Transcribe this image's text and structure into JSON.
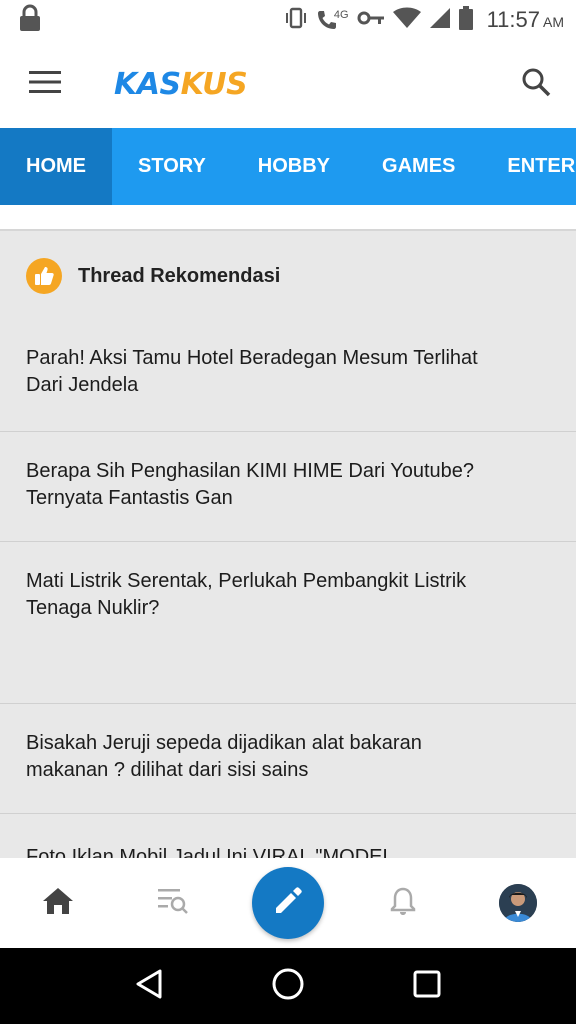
{
  "status_bar": {
    "network_type": "4G",
    "time": "11:57",
    "ampm": "AM",
    "icons": [
      "lock-icon",
      "vibrate-icon",
      "call-icon",
      "vpn-key-icon",
      "wifi-icon",
      "cell-signal-icon",
      "battery-icon"
    ]
  },
  "app_bar": {
    "logo_part1": "KAS",
    "logo_part2": "KUS",
    "icons": [
      "menu-icon",
      "search-icon"
    ],
    "colors": {
      "logo_blue": "#1e88e5",
      "logo_orange": "#f5a623"
    }
  },
  "tabs": [
    {
      "label": "HOME",
      "active": true
    },
    {
      "label": "STORY",
      "active": false
    },
    {
      "label": "HOBBY",
      "active": false
    },
    {
      "label": "GAMES",
      "active": false
    },
    {
      "label": "ENTER",
      "active": false
    }
  ],
  "section": {
    "icon": "thumbs-up-icon",
    "title": "Thread Rekomendasi"
  },
  "threads": [
    {
      "line1": "Parah! Aksi Tamu Hotel Beradegan Mesum Terlihat",
      "line2": "Dari Jendela"
    },
    {
      "line1": "Berapa Sih Penghasilan KIMI HIME Dari Youtube?",
      "line2": "Ternyata Fantastis Gan"
    },
    {
      "line1": "Mati Listrik Serentak, Perlukah Pembangkit Listrik",
      "line2": "Tenaga Nuklir?"
    },
    {
      "line1": "Bisakah Jeruji sepeda dijadikan alat bakaran",
      "line2": "makanan ? dilihat dari sisi sains"
    },
    {
      "line1": "Foto Iklan Mobil Jadul Ini VIRAL \"MODEL",
      "line2": ""
    }
  ],
  "bottom_nav": {
    "icons": [
      "home-icon",
      "search-list-icon",
      "edit-icon",
      "bell-icon",
      "avatar"
    ],
    "colors": {
      "fab": "#1479c4",
      "tab_bar": "#1e9af0",
      "tab_active": "#1479c4"
    }
  },
  "system_nav": {
    "icons": [
      "back-icon",
      "home-circle-icon",
      "recents-icon"
    ]
  }
}
